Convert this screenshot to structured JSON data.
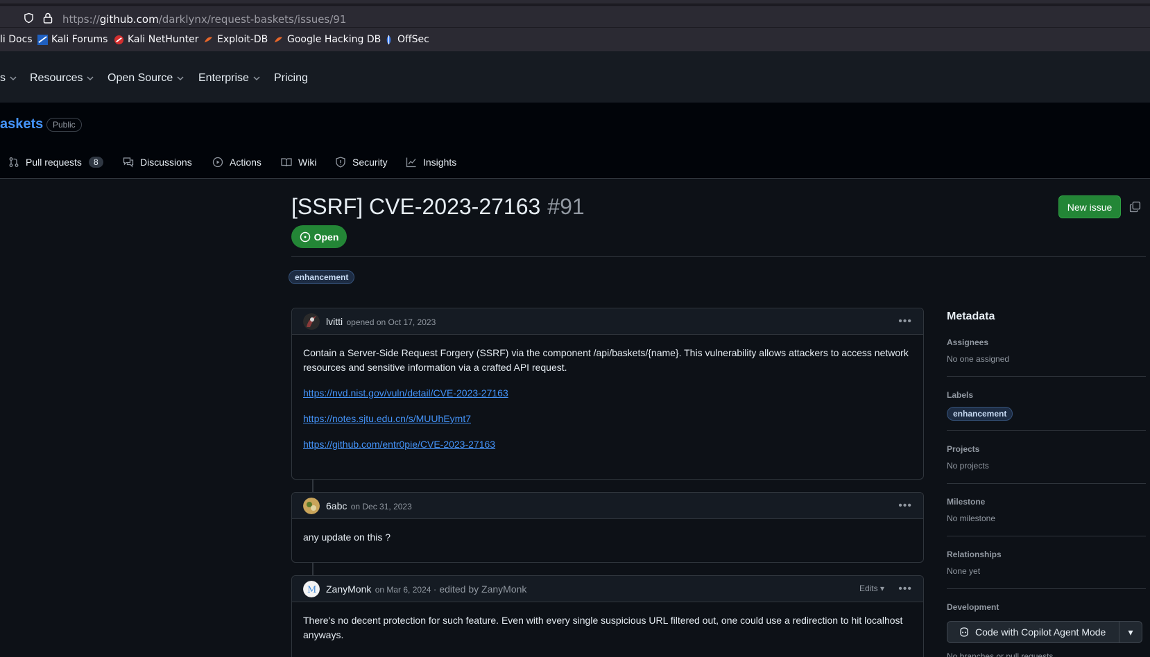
{
  "browser": {
    "url_prefix": "https://",
    "url_host": "github.com",
    "url_path": "/darklynx/request-baskets/issues/91"
  },
  "bookmarks": [
    {
      "label": "li Docs",
      "icon": "kali-docs-icon"
    },
    {
      "label": "Kali Forums",
      "icon": "kali-forums-icon"
    },
    {
      "label": "Kali NetHunter",
      "icon": "kali-nethunter-icon"
    },
    {
      "label": "Exploit-DB",
      "icon": "exploit-db-icon"
    },
    {
      "label": "Google Hacking DB",
      "icon": "ghdb-icon"
    },
    {
      "label": "OffSec",
      "icon": "offsec-icon"
    }
  ],
  "header": {
    "nav": [
      {
        "label": "s"
      },
      {
        "label": "Resources"
      },
      {
        "label": "Open Source"
      },
      {
        "label": "Enterprise"
      },
      {
        "label": "Pricing"
      }
    ]
  },
  "repo": {
    "name": "askets",
    "visibility": "Public",
    "tabs": [
      {
        "label": "Pull requests",
        "count": "8",
        "icon": "pull-request-icon"
      },
      {
        "label": "Discussions",
        "icon": "discussions-icon"
      },
      {
        "label": "Actions",
        "icon": "actions-icon"
      },
      {
        "label": "Wiki",
        "icon": "wiki-icon"
      },
      {
        "label": "Security",
        "icon": "security-icon"
      },
      {
        "label": "Insights",
        "icon": "insights-icon"
      }
    ]
  },
  "issue": {
    "title": "[SSRF] CVE-2023-27163",
    "number": "#91",
    "state": "Open",
    "new_issue_label": "New issue",
    "labels": [
      "enhancement"
    ]
  },
  "comments": [
    {
      "author": "lvitti",
      "meta": "opened on Oct 17, 2023",
      "body": "Contain a Server-Side Request Forgery (SSRF) via the component /api/baskets/{name}. This vulnerability allows attackers to access network resources and sensitive information via a crafted API request.",
      "links": [
        "https://nvd.nist.gov/vuln/detail/CVE-2023-27163",
        "https://notes.sjtu.edu.cn/s/MUUhEymt7",
        "https://github.com/entr0pie/CVE-2023-27163"
      ]
    },
    {
      "author": "6abc",
      "meta": "on Dec 31, 2023",
      "body": "any update on this ?"
    },
    {
      "author": "ZanyMonk",
      "meta": "on Mar 6, 2024",
      "edited": "· edited by ZanyMonk",
      "edits_label": "Edits",
      "body": "There's no decent protection for such feature. Even with every single suspicious URL filtered out, one could use a redirection to hit localhost anyways."
    }
  ],
  "sidebar": {
    "title": "Metadata",
    "assignees": {
      "heading": "Assignees",
      "value": "No one assigned"
    },
    "labels": {
      "heading": "Labels",
      "value": "enhancement"
    },
    "projects": {
      "heading": "Projects",
      "value": "No projects"
    },
    "milestone": {
      "heading": "Milestone",
      "value": "No milestone"
    },
    "relationships": {
      "heading": "Relationships",
      "value": "None yet"
    },
    "development": {
      "heading": "Development",
      "button": "Code with Copilot Agent Mode",
      "cut_text": "No branches or pull requests"
    }
  },
  "colors": {
    "bg": "#0d1117",
    "accent_link": "#4493f8",
    "open_green": "#238636"
  }
}
